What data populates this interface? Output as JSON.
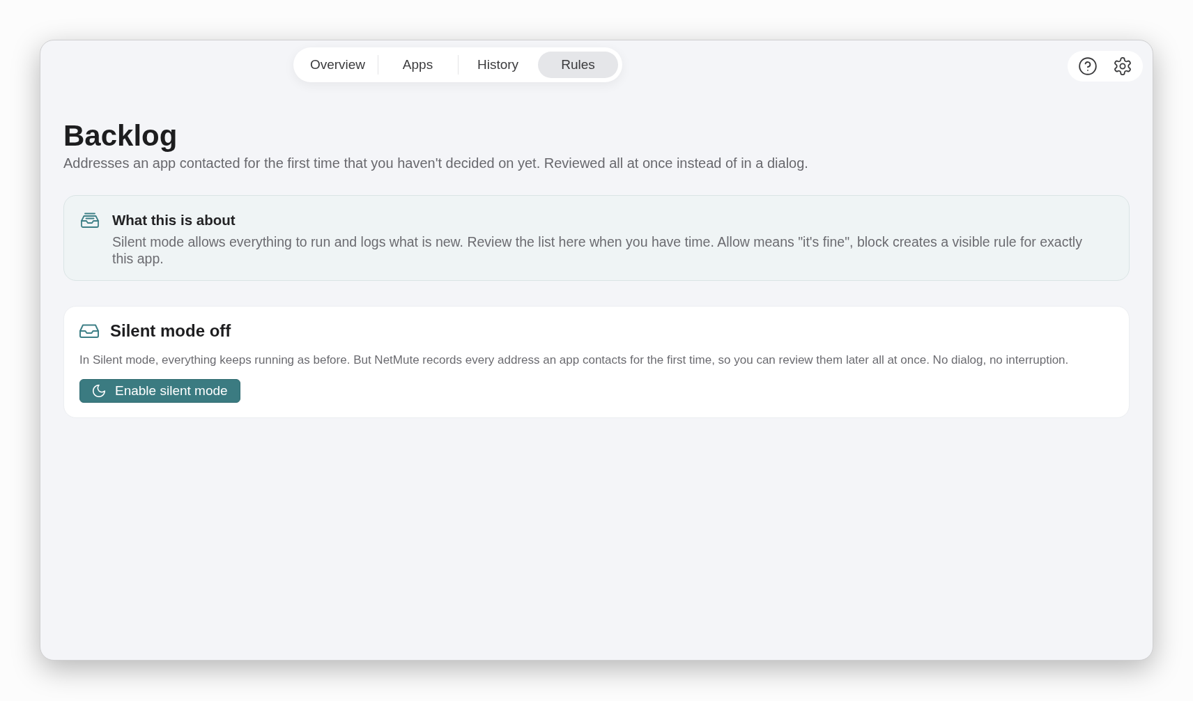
{
  "tabs": [
    {
      "label": "Overview",
      "selected": false
    },
    {
      "label": "Apps",
      "selected": false
    },
    {
      "label": "History",
      "selected": false
    },
    {
      "label": "Rules",
      "selected": true
    }
  ],
  "header": {
    "title": "Backlog",
    "subtitle": "Addresses an app contacted for the first time that you haven't decided on yet. Reviewed all at once instead of in a dialog."
  },
  "info_card": {
    "title": "What this is about",
    "text": "Silent mode allows everything to run and logs what is new. Review the list here when you have time. Allow means \"it's fine\", block creates a visible rule for exactly this app."
  },
  "silent_mode_card": {
    "title": "Silent mode off",
    "text": "In Silent mode, everything keeps running as before. But NetMute records every address an app contacts for the first time, so you can review them later all at once. No dialog, no interruption.",
    "button": "Enable silent mode"
  }
}
